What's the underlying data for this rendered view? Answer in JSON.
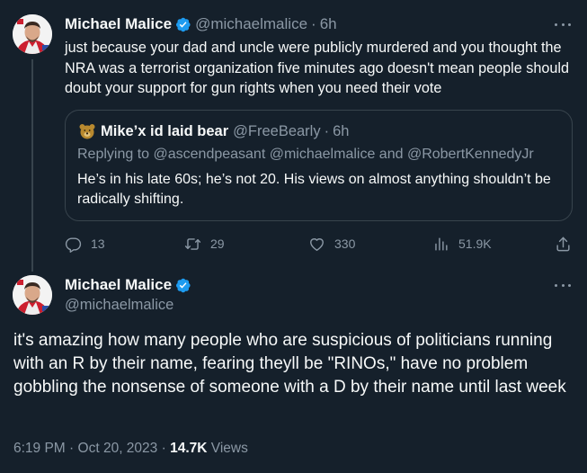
{
  "colors": {
    "background": "#15202b",
    "text": "#f7f9f9",
    "muted": "#8b98a5",
    "border": "#38444d",
    "verified": "#1d9bf0"
  },
  "icons": {
    "verified": "verified-badge-icon",
    "more": "more-icon",
    "reply": "reply-icon",
    "retweet": "retweet-icon",
    "like": "heart-icon",
    "views": "views-chart-icon",
    "share": "share-icon"
  },
  "parent_tweet": {
    "author_name": "Michael Malice",
    "handle": "@michaelmalice",
    "separator": "·",
    "time": "6h",
    "text": "just because your dad and uncle were publicly murdered and you thought the NRA was a terrorist organization five minutes ago doesn't mean people should doubt your support for gun rights when you need their vote",
    "quote": {
      "author_name": "Mike’x id laid bear",
      "handle": "@FreeBearly",
      "separator": "·",
      "time": "6h",
      "replying_to_label": "Replying to",
      "mention_1": "@ascendpeasant",
      "mention_2": "@michaelmalice",
      "and_label": "and",
      "mention_3": "@RobertKennedyJr",
      "text": "He’s in his late 60s; he’s not 20. His views on almost anything shouldn’t be radically shifting."
    },
    "stats": {
      "replies": "13",
      "retweets": "29",
      "likes": "330",
      "views": "51.9K"
    }
  },
  "main_tweet": {
    "author_name": "Michael Malice",
    "handle": "@michaelmalice",
    "text": "it's amazing how many people who are suspicious of politicians running with an R by their name, fearing theyll be \"RINOs,\" have no problem gobbling the nonsense of someone with a D by their name until last week",
    "time": "6:19 PM",
    "separator": "·",
    "date": "Oct 20, 2023",
    "separator_2": "·",
    "views_count": "14.7K",
    "views_label": "Views"
  }
}
